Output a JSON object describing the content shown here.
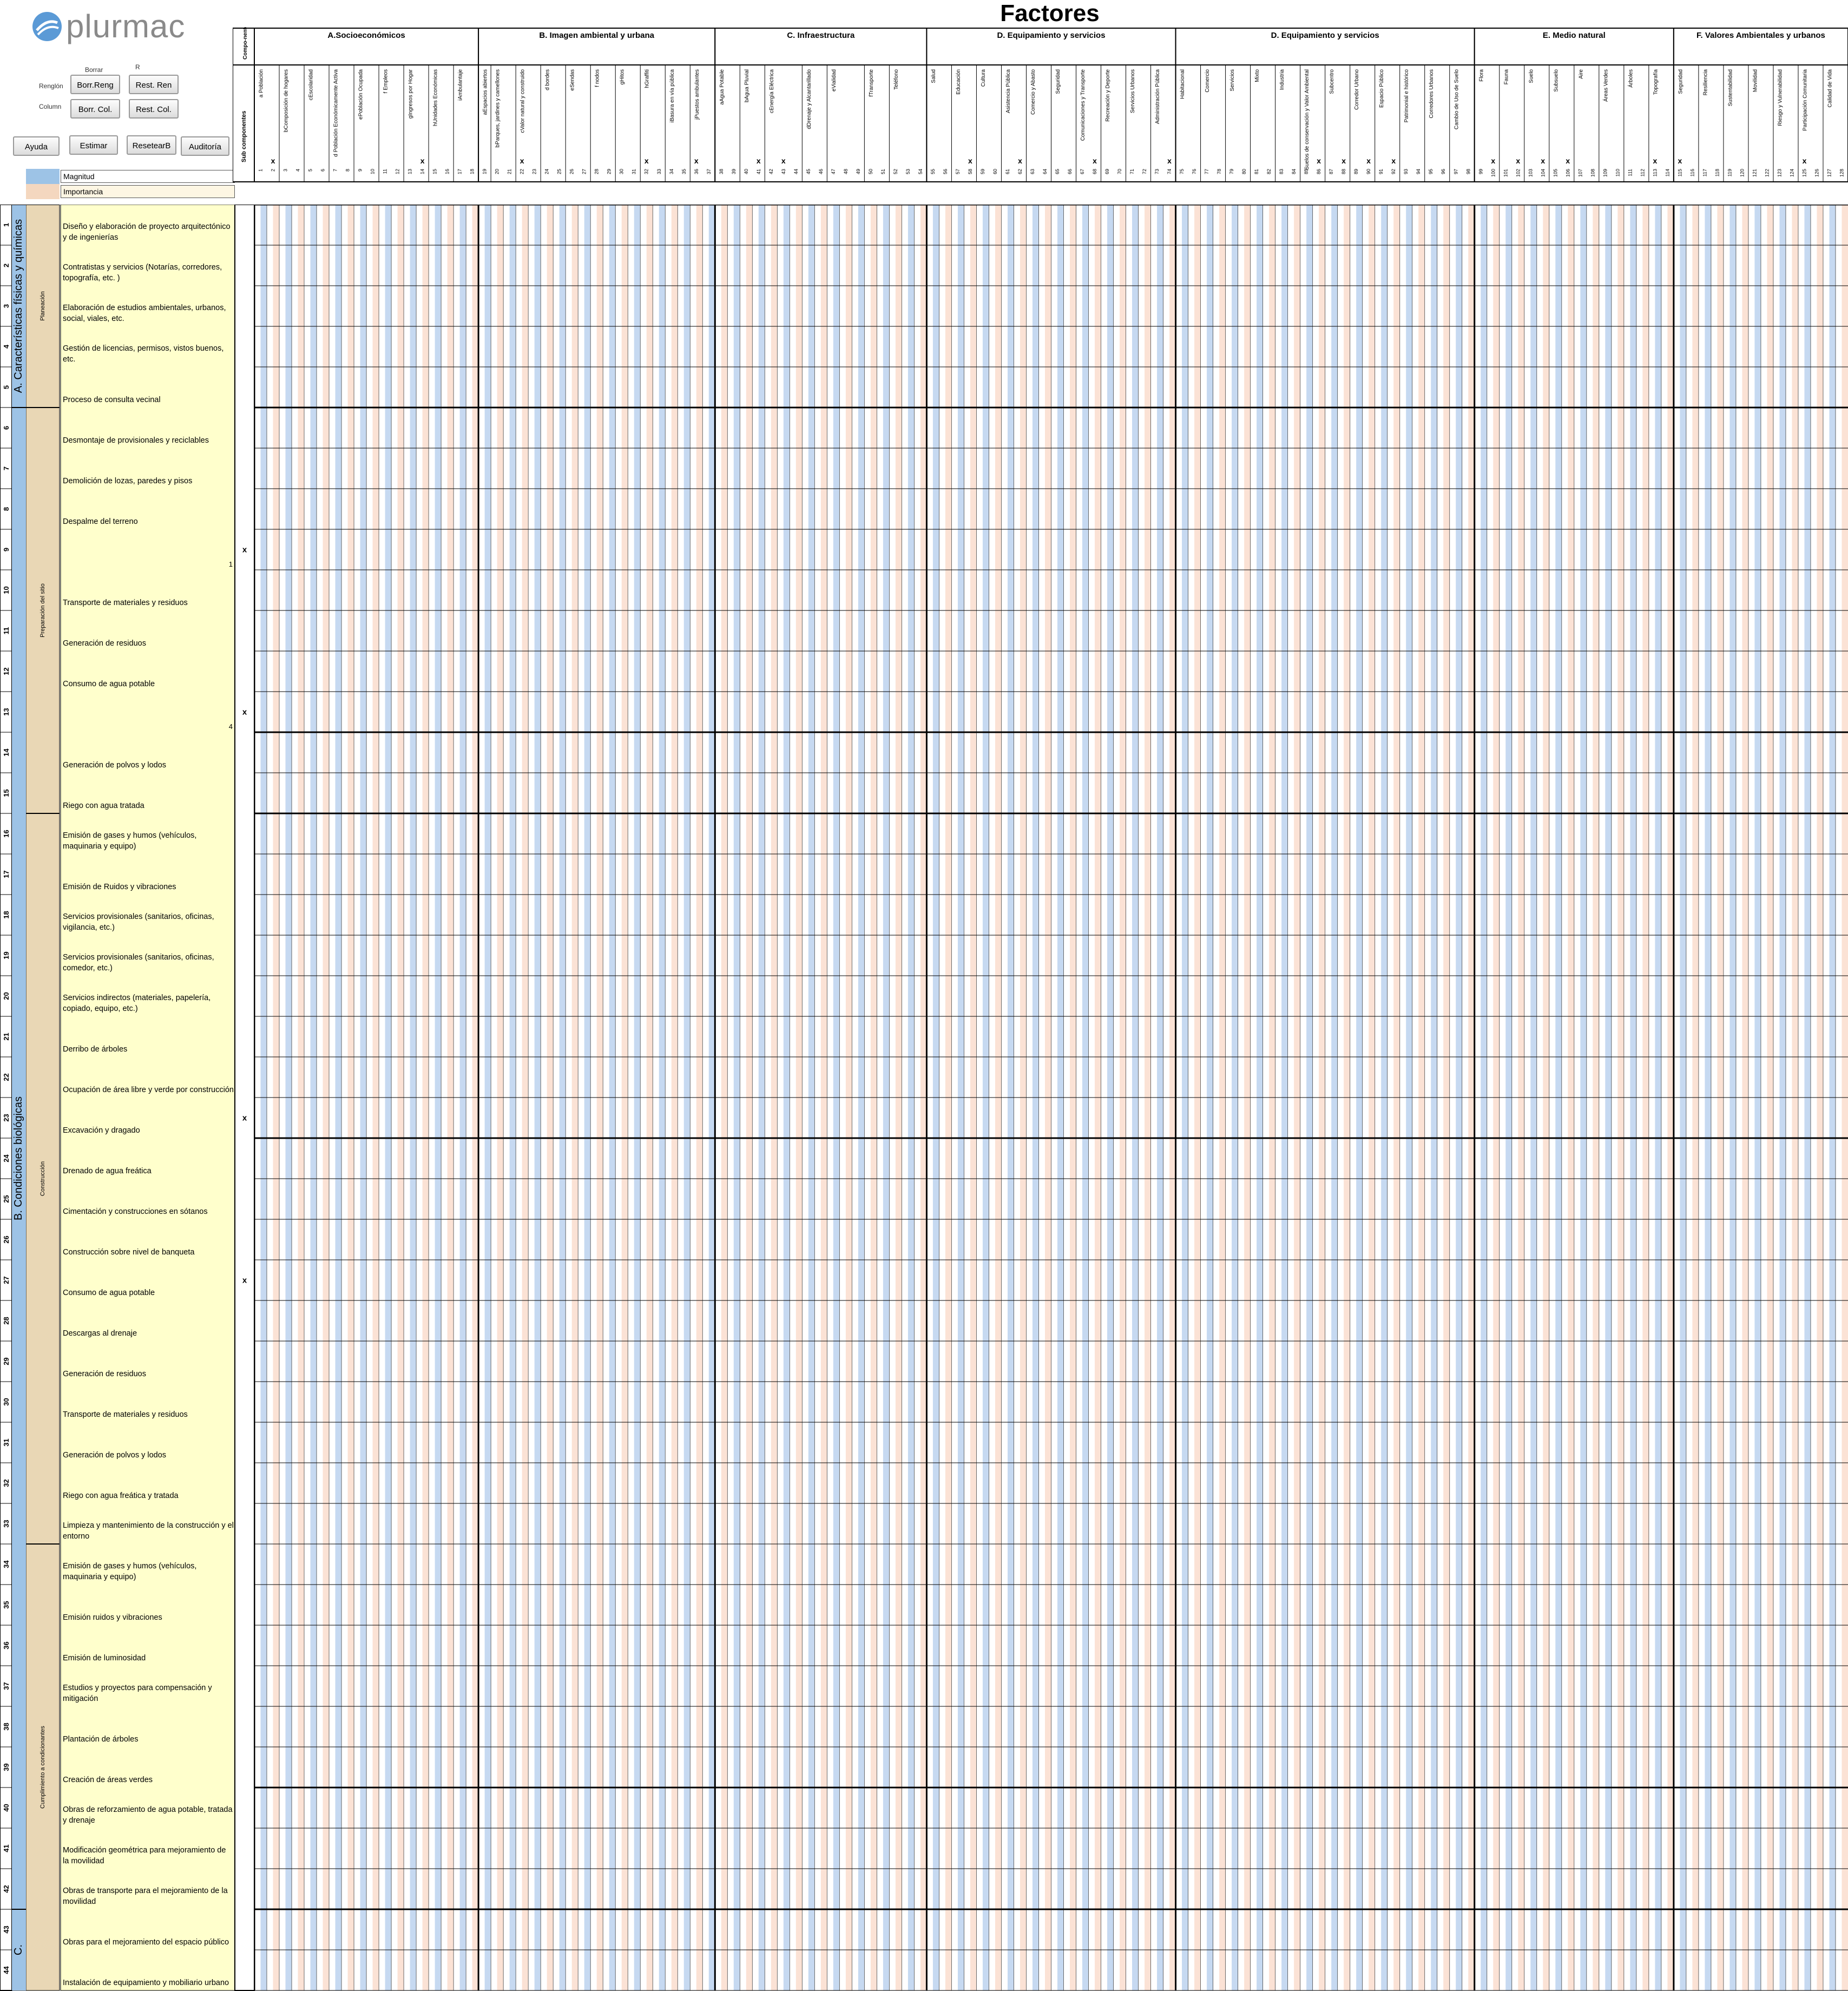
{
  "brand": {
    "name": "plurmac",
    "color": "#8a8a8a",
    "logo_icon": "plurmac-logo-icon"
  },
  "title": "Factores",
  "controls": {
    "borrar_label": "Borrar",
    "r_label": "R",
    "renglon_label": "Renglón",
    "column_label": "Column",
    "borr_reng": "Borr.Reng",
    "rest_ren": "Rest. Ren",
    "borr_col": "Borr. Col.",
    "rest_col": "Rest. Col.",
    "ayuda": "Ayuda",
    "estimar": "Estimar",
    "resetear": "ResetearB",
    "auditoria": "Auditoría"
  },
  "legend": {
    "magnitud": "Magnitud",
    "importancia": "Importancia",
    "magnitud_color": "#c6d9f1",
    "importancia_color": "#fbe2d5"
  },
  "header": {
    "componentes_label": "Compo-nentes",
    "sub_componentes_label": "Sub componentes",
    "groups": [
      {
        "label": "A.Socioeconómicos"
      },
      {
        "label": "B. Imagen ambiental y urbana"
      },
      {
        "label": "C. Infraestructura"
      },
      {
        "label": "D. Equipamiento y servicios"
      },
      {
        "label": "D. Equipamiento y servicios"
      },
      {
        "label": "E. Medio natural"
      },
      {
        "label": "F. Valores Ambientales y urbanos"
      }
    ],
    "subcomponents": [
      [
        "a Población",
        "bComposición de hogares",
        "cEscolaridad",
        "d Población Económicamente Activa",
        "ePoblación Ocupada",
        "f Empleos",
        "gIngresos por Hogar",
        "hUnidades Económicas",
        "iAmbulantaje"
      ],
      [
        "aEspacios abiertos",
        "bParques, jardines y camellones",
        "cValor natural y construido",
        "d bordes",
        "eSendas",
        "f nodos",
        "gHitos",
        "hGraffiti",
        "iBasura en vía pública",
        "jPuestos ambulantes"
      ],
      [
        "aAgua Potable",
        "bAgua Pluvial",
        "cEnergía Eléctrica",
        "dDrenaje y Alcantarillado",
        "eVialidad",
        "fTransporte",
        "Teléfono"
      ],
      [
        "Salud",
        "Educación",
        "Cultura",
        "Asistencia Pública",
        "Comercio y Abasto",
        "Seguridad",
        "Comunicaciones y Transporte",
        "Recreación y Deporte",
        "Servicios Urbanos",
        "Administración Pública"
      ],
      [
        "Habitacional",
        "Comercio",
        "Servicios",
        "Mixto",
        "Industria",
        "Suelos de conservación y Valor Ambiental",
        "Subcentro",
        "Corredor Urbano",
        "Espacio Público",
        "Patrimonial e histórico",
        "Corredores Urbanos",
        "Cambio de Uso de Suelo"
      ],
      [
        "Flora",
        "Fauna",
        "Suelo",
        "Subsuelo",
        "Aire",
        "Áreas Verdes",
        "Árboles",
        "Topografía"
      ],
      [
        "Seguridad",
        "Resiliencia",
        "Sustentabilidad",
        "Movilidad",
        "Riesgo y Vulnerabilidad",
        "Participación Comunitaria",
        "Calidad de Vida"
      ]
    ],
    "column_count": 128,
    "x_marked_columns": [
      2,
      14,
      22,
      32,
      36,
      41,
      43,
      58,
      62,
      68,
      74,
      86,
      88,
      90,
      92,
      100,
      102,
      104,
      106,
      113,
      115,
      125
    ]
  },
  "sections": [
    {
      "label": "A. Características físicas y químicas",
      "start": 1,
      "end": 5
    },
    {
      "label": "B. Condiciones biológicas",
      "start": 6,
      "end": 42
    },
    {
      "label": "C.",
      "start": 43,
      "end": 44
    }
  ],
  "phases": [
    {
      "label": "Planeación",
      "start": 1,
      "end": 5
    },
    {
      "label": "Preparación del sitio",
      "start": 6,
      "end": 15
    },
    {
      "label": "Construcción",
      "start": 16,
      "end": 33
    },
    {
      "label": "Cumplimiento a condicionantes",
      "start": 34,
      "end": 44
    }
  ],
  "rows": [
    {
      "n": "1",
      "label": "Diseño y elaboración de proyecto arquitectónico y de ingenierías",
      "x": "",
      "val": ""
    },
    {
      "n": "2",
      "label": "Contratistas y servicios (Notarías, corredores, topografía, etc. )",
      "x": "",
      "val": ""
    },
    {
      "n": "3",
      "label": "Elaboración de estudios ambientales, urbanos, social, viales, etc.",
      "x": "",
      "val": ""
    },
    {
      "n": "4",
      "label": "Gestión de licencias, permisos, vistos buenos, etc.",
      "x": "",
      "val": ""
    },
    {
      "n": "5",
      "label": "Proceso de consulta vecinal",
      "x": "",
      "val": ""
    },
    {
      "n": "6",
      "label": "Desmontaje de provisionales y reciclables",
      "x": "",
      "val": ""
    },
    {
      "n": "7",
      "label": "Demolición de lozas, paredes y pisos",
      "x": "",
      "val": ""
    },
    {
      "n": "8",
      "label": "Despalme del terreno",
      "x": "",
      "val": ""
    },
    {
      "n": "9",
      "label": "",
      "x": "x",
      "val": "1"
    },
    {
      "n": "10",
      "label": "Transporte de materiales y residuos",
      "x": "",
      "val": ""
    },
    {
      "n": "11",
      "label": "Generación de residuos",
      "x": "",
      "val": ""
    },
    {
      "n": "12",
      "label": "Consumo de agua potable",
      "x": "",
      "val": ""
    },
    {
      "n": "13",
      "label": "",
      "x": "x",
      "val": "4"
    },
    {
      "n": "14",
      "label": "Generación de polvos y lodos",
      "x": "",
      "val": ""
    },
    {
      "n": "15",
      "label": "Riego con agua tratada",
      "x": "",
      "val": ""
    },
    {
      "n": "16",
      "label": "Emisión de gases y humos (vehículos, maquinaria y equipo)",
      "x": "",
      "val": ""
    },
    {
      "n": "17",
      "label": "Emisión de Ruidos y vibraciones",
      "x": "",
      "val": ""
    },
    {
      "n": "18",
      "label": "Servicios provisionales (sanitarios, oficinas, vigilancia, etc.)",
      "x": "",
      "val": ""
    },
    {
      "n": "19",
      "label": "Servicios provisionales (sanitarios, oficinas, comedor, etc.)",
      "x": "",
      "val": ""
    },
    {
      "n": "20",
      "label": "Servicios indirectos (materiales, papelería, copiado, equipo, etc.)",
      "x": "",
      "val": ""
    },
    {
      "n": "21",
      "label": "Derribo de árboles",
      "x": "",
      "val": ""
    },
    {
      "n": "22",
      "label": "Ocupación de área libre y verde por construcción",
      "x": "",
      "val": ""
    },
    {
      "n": "23",
      "label": "Excavación y dragado",
      "x": "x",
      "val": ""
    },
    {
      "n": "24",
      "label": "Drenado de agua freática",
      "x": "",
      "val": ""
    },
    {
      "n": "25",
      "label": "Cimentación y construcciones en sótanos",
      "x": "",
      "val": ""
    },
    {
      "n": "26",
      "label": "Construcción sobre nivel de banqueta",
      "x": "",
      "val": ""
    },
    {
      "n": "27",
      "label": "Consumo de agua potable",
      "x": "x",
      "val": ""
    },
    {
      "n": "28",
      "label": "Descargas al drenaje",
      "x": "",
      "val": ""
    },
    {
      "n": "29",
      "label": "Generación de residuos",
      "x": "",
      "val": ""
    },
    {
      "n": "30",
      "label": "Transporte de materiales y residuos",
      "x": "",
      "val": ""
    },
    {
      "n": "31",
      "label": "Generación de polvos y lodos",
      "x": "",
      "val": ""
    },
    {
      "n": "32",
      "label": "Riego con agua freática y tratada",
      "x": "",
      "val": ""
    },
    {
      "n": "33",
      "label": "Limpieza y mantenimiento de la construcción y el entorno",
      "x": "",
      "val": ""
    },
    {
      "n": "34",
      "label": "Emisión de gases y humos (vehículos, maquinaria y equipo)",
      "x": "",
      "val": ""
    },
    {
      "n": "35",
      "label": "Emisión ruidos y vibraciones",
      "x": "",
      "val": ""
    },
    {
      "n": "36",
      "label": "Emisión de luminosidad",
      "x": "",
      "val": ""
    },
    {
      "n": "37",
      "label": "Estudios y proyectos para compensación y mitigación",
      "x": "",
      "val": ""
    },
    {
      "n": "38",
      "label": "Plantación de árboles",
      "x": "",
      "val": ""
    },
    {
      "n": "39",
      "label": "Creación de áreas verdes",
      "x": "",
      "val": ""
    },
    {
      "n": "40",
      "label": "Obras de reforzamiento de agua potable, tratada y drenaje",
      "x": "",
      "val": ""
    },
    {
      "n": "41",
      "label": "Modificación geométrica para mejoramiento de la movilidad",
      "x": "",
      "val": ""
    },
    {
      "n": "42",
      "label": "Obras de transporte para el mejoramiento de la movilidad",
      "x": "",
      "val": ""
    },
    {
      "n": "43",
      "label": "Obras para el mejoramiento del espacio público",
      "x": "",
      "val": ""
    },
    {
      "n": "44",
      "label": "Instalación de equipamiento y mobiliario urbano",
      "x": "",
      "val": ""
    }
  ]
}
